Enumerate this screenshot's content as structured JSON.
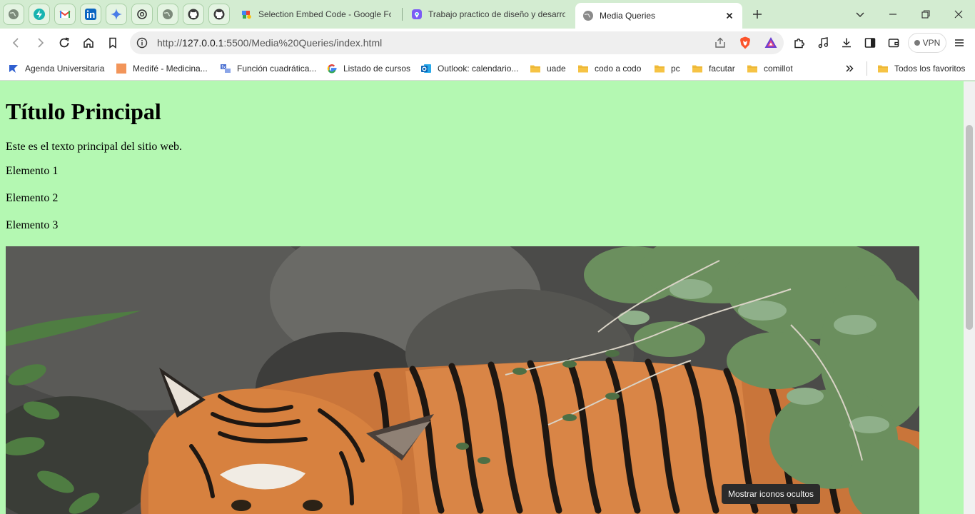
{
  "browser": {
    "tabs": [
      {
        "title": "Selection Embed Code - Google Fonts",
        "active": false
      },
      {
        "title": "Trabajo practico de diseño y desarrollo",
        "active": false
      },
      {
        "title": "Media Queries",
        "active": true
      }
    ],
    "address": {
      "scheme": "http://",
      "host": "127.0.0.1",
      "rest": ":5500/Media%20Queries/index.html"
    },
    "vpn_label": "VPN",
    "bookmarks": [
      {
        "label": "Agenda Universitaria",
        "icon": "agenda-icon"
      },
      {
        "label": "Medifé - Medicina...",
        "icon": "medife-icon"
      },
      {
        "label": "Función cuadrática...",
        "icon": "math-icon"
      },
      {
        "label": "Listado de cursos",
        "icon": "google-icon"
      },
      {
        "label": "Outlook: calendario...",
        "icon": "outlook-icon"
      },
      {
        "label": "uade",
        "icon": "folder-icon"
      },
      {
        "label": "codo a codo",
        "icon": "folder-icon"
      },
      {
        "label": "pc",
        "icon": "folder-icon"
      },
      {
        "label": "facutar",
        "icon": "folder-icon"
      },
      {
        "label": "comillot",
        "icon": "folder-icon"
      }
    ],
    "all_bookmarks_label": "Todos los favoritos",
    "tooltip": "Mostrar iconos ocultos"
  },
  "page": {
    "title": "Título Principal",
    "intro": "Este es el texto principal del sitio web.",
    "items": [
      "Elemento 1",
      "Elemento 2",
      "Elemento 3"
    ],
    "background_color": "#b4f8b2"
  },
  "colors": {
    "tabstrip_bg": "#d3ecd1",
    "brave_orange": "#fb542b",
    "folder_yellow": "#f6c344"
  }
}
